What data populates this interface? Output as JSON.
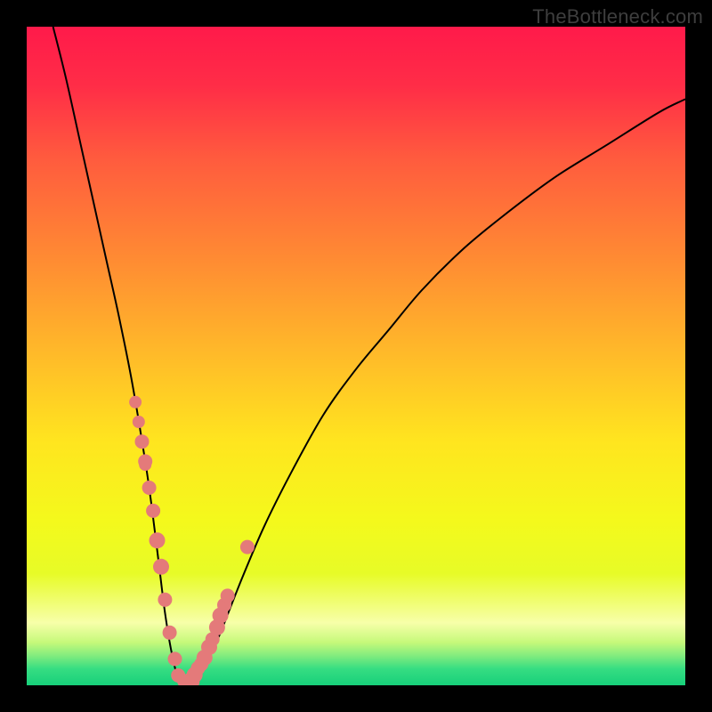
{
  "watermark": "TheBottleneck.com",
  "gradient": {
    "stops": [
      {
        "offset": 0.0,
        "color": "#ff1a4a"
      },
      {
        "offset": 0.09,
        "color": "#ff2d47"
      },
      {
        "offset": 0.2,
        "color": "#ff5b3e"
      },
      {
        "offset": 0.35,
        "color": "#ff8a33"
      },
      {
        "offset": 0.5,
        "color": "#ffbb29"
      },
      {
        "offset": 0.63,
        "color": "#ffe51f"
      },
      {
        "offset": 0.75,
        "color": "#f4f91c"
      },
      {
        "offset": 0.83,
        "color": "#e7fb27"
      },
      {
        "offset": 0.905,
        "color": "#f7ffa9"
      },
      {
        "offset": 0.935,
        "color": "#c5f97a"
      },
      {
        "offset": 0.955,
        "color": "#82ec7e"
      },
      {
        "offset": 0.975,
        "color": "#36dd82"
      },
      {
        "offset": 1.0,
        "color": "#17d07a"
      }
    ]
  },
  "chart_data": {
    "type": "line",
    "title": "",
    "xlabel": "",
    "ylabel": "",
    "xlim": [
      0,
      100
    ],
    "ylim": [
      0,
      100
    ],
    "grid": false,
    "series": [
      {
        "name": "bottleneck-curve",
        "x": [
          4,
          6,
          8,
          10,
          12,
          14,
          16,
          18,
          19,
          20,
          21,
          22,
          23,
          24,
          25,
          27,
          29,
          31,
          33,
          36,
          40,
          45,
          50,
          55,
          60,
          66,
          72,
          80,
          88,
          96,
          100
        ],
        "values": [
          100,
          92,
          83,
          74,
          65,
          56,
          46,
          34,
          27,
          19,
          11,
          5,
          1,
          0,
          0.5,
          3,
          7,
          12,
          17,
          24,
          32,
          41,
          48,
          54,
          60,
          66,
          71,
          77,
          82,
          87,
          89
        ]
      }
    ],
    "points": {
      "name": "highlighted-points",
      "color": "#e47a7a",
      "x": [
        16.5,
        17.0,
        17.5,
        18.0,
        18.0,
        18.6,
        19.2,
        19.8,
        20.4,
        21.0,
        21.7,
        22.5,
        23.0,
        23.8,
        24.5,
        24.9,
        25.5,
        26.0,
        26.5,
        27.0,
        27.7,
        28.2,
        28.9,
        29.4,
        30.0,
        30.5,
        33.5
      ],
      "values": [
        43.0,
        40.0,
        37.0,
        34.0,
        33.5,
        30.0,
        26.5,
        22.0,
        18.0,
        13.0,
        8.0,
        4.0,
        1.5,
        0.6,
        0.4,
        0.6,
        1.6,
        2.6,
        3.2,
        4.2,
        5.8,
        7.0,
        8.8,
        10.6,
        12.2,
        13.6,
        21.0
      ],
      "r": [
        7,
        7,
        8,
        8,
        7,
        8,
        8,
        9,
        9,
        8,
        8,
        8,
        8,
        7,
        9,
        10,
        9,
        8,
        8,
        9,
        9,
        8,
        9,
        9,
        8,
        8,
        8
      ]
    }
  }
}
